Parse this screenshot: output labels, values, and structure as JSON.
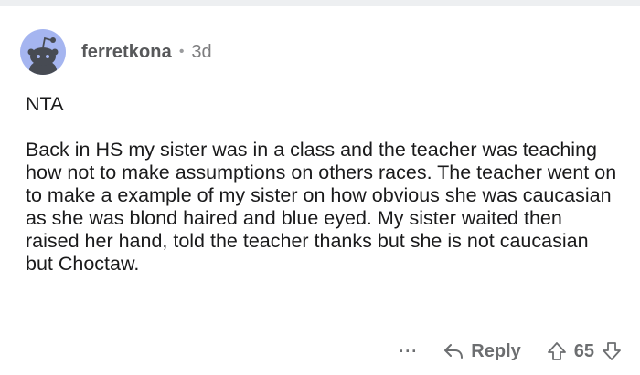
{
  "comment": {
    "username": "ferretkona",
    "separator": "•",
    "age": "3d",
    "body_lead": "NTA",
    "body_main": "Back in HS my sister was in a class and the teacher was teaching how not to make assumptions on others races. The teacher went on to make a example of my sister on how obvious she was caucasian as she was blond haired and blue eyed.  My sister waited then raised her hand, told the teacher thanks but she is not caucasian but Choctaw."
  },
  "actions": {
    "more_label": "···",
    "reply_label": "Reply",
    "vote_count": "65"
  },
  "icons": {
    "avatar": "snoo-avatar-icon",
    "reply": "reply-arrow-icon",
    "upvote": "upvote-arrow-icon",
    "downvote": "downvote-arrow-icon"
  },
  "colors": {
    "avatar_bg": "#a5b5f0",
    "meta_text": "#57585a",
    "action_text": "#6c6e70"
  }
}
